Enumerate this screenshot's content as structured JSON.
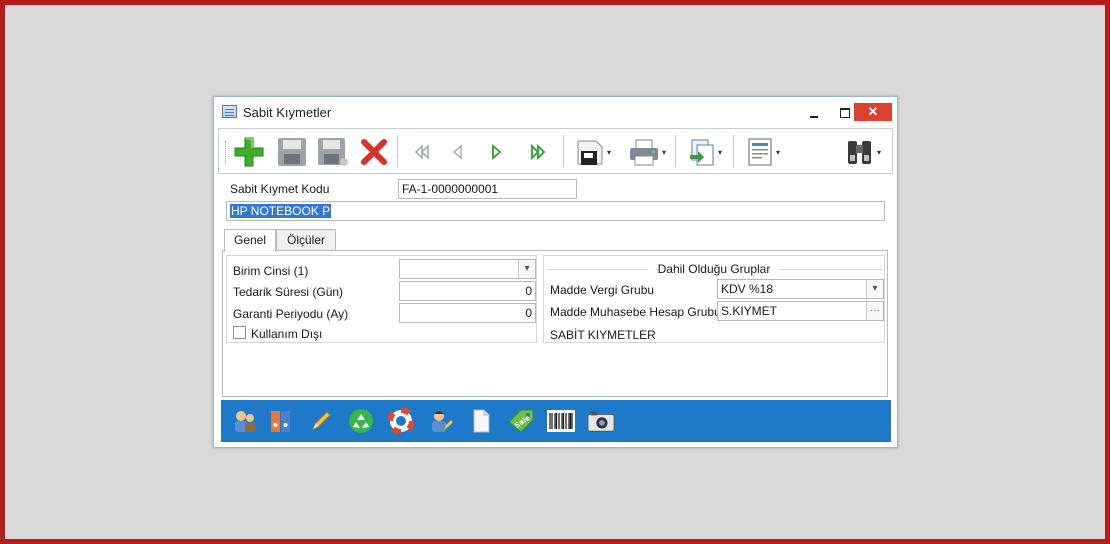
{
  "window": {
    "title": "Sabit Kıymetler",
    "close_glyph": "✕"
  },
  "toolbar": {
    "icons": [
      "add-icon",
      "save-icon",
      "save-as-icon",
      "delete-icon",
      "first-record-icon",
      "previous-record-icon",
      "next-record-icon",
      "last-record-icon",
      "save-disk-menu-icon",
      "print-icon",
      "copy-document-icon",
      "report-icon",
      "search-binoculars-icon"
    ],
    "caret": "▾"
  },
  "header": {
    "code_label": "Sabit Kıymet Kodu",
    "code_value": "FA-1-0000000001",
    "name_value": "HP NOTEBOOK P"
  },
  "tabs": [
    "Genel",
    "Ölçüler"
  ],
  "general": {
    "unit_type_label": "Birim Cinsi (1)",
    "unit_type_value": "",
    "lead_time_label": "Tedarik Süresi (Gün)",
    "lead_time_value": "0",
    "warranty_label": "Garanti Periyodu (Ay)",
    "warranty_value": "0",
    "out_of_use_label": "Kullanım Dışı",
    "out_of_use_checked": false
  },
  "groups": {
    "title": "Dahil Olduğu Gruplar",
    "tax_group_label": "Madde Vergi Grubu",
    "tax_group_value": "KDV %18",
    "accounting_group_label": "Madde Muhasebe Hesap Grubu",
    "accounting_group_value": "S.KIYMET",
    "accounting_group_desc": "SABİT KIYMETLER",
    "ellipsis": "···",
    "dropdown_glyph": "▾"
  },
  "bottom_icons": [
    "users-icon",
    "binders-icon",
    "pencil-icon",
    "recycle-icon",
    "lifebuoy-icon",
    "user-edit-icon",
    "document-icon",
    "sale-tag-icon",
    "barcode-icon",
    "camera-icon"
  ],
  "bottom_sale_text": "Sale",
  "colors": {
    "frame": "#b51d1d",
    "bottom_bar": "#1f79c9",
    "close_button": "#d9402d",
    "selection": "#3478d6"
  }
}
